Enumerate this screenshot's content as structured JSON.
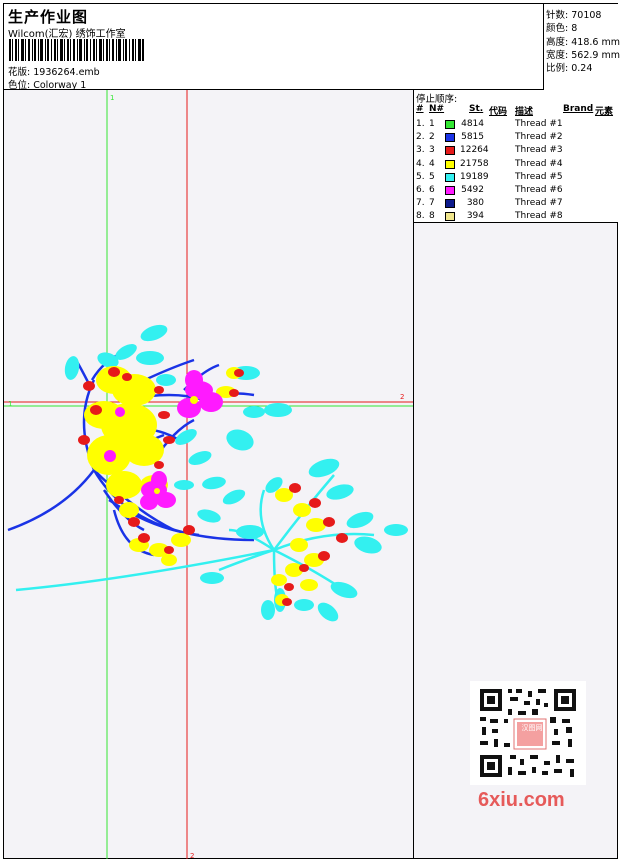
{
  "header": {
    "title": "生产作业图",
    "subtitle": "Wilcom(汇宏) 绣饰工作室",
    "design_label": "花版:",
    "design_file": "1936264.emb",
    "colorway_label": "色位:",
    "colorway": "Colorway 1"
  },
  "stats": {
    "stitches_label": "针数:",
    "stitches": "70108",
    "colors_label": "颜色:",
    "colors": "8",
    "height_label": "高度:",
    "height": "418.6 mm",
    "width_label": "宽度:",
    "width": "562.9 mm",
    "ratio_label": "比例:",
    "ratio": "0.24"
  },
  "thread_panel": {
    "title": "停止顺序:",
    "columns": {
      "index": "#",
      "needle": "N#",
      "stitches": "St.",
      "code": "代码",
      "desc": "描述",
      "brand": "Brand",
      "element": "元素"
    },
    "rows": [
      {
        "idx": "1.",
        "n": "1",
        "color": "#33e633",
        "st": "4814",
        "desc": "Thread #1"
      },
      {
        "idx": "2.",
        "n": "2",
        "color": "#1a33e6",
        "st": "5815",
        "desc": "Thread #2"
      },
      {
        "idx": "3.",
        "n": "3",
        "color": "#e61a1a",
        "st": "12264",
        "desc": "Thread #3"
      },
      {
        "idx": "4.",
        "n": "4",
        "color": "#ffff00",
        "st": "21758",
        "desc": "Thread #4"
      },
      {
        "idx": "5.",
        "n": "5",
        "color": "#33f0f0",
        "st": "19189",
        "desc": "Thread #5"
      },
      {
        "idx": "6.",
        "n": "6",
        "color": "#ff1aff",
        "st": "5492",
        "desc": "Thread #6"
      },
      {
        "idx": "7.",
        "n": "7",
        "color": "#0d1a8c",
        "st": "380",
        "desc": "Thread #7"
      },
      {
        "idx": "8.",
        "n": "8",
        "color": "#f0e68c",
        "st": "394",
        "desc": "Thread #8"
      }
    ]
  },
  "axis_labels": {
    "x_end": "2",
    "y_end": "2",
    "x_start": "1",
    "y_start": "1"
  },
  "colors": {
    "green_axis": "#33e633",
    "red_axis": "#e61a1a",
    "blue": "#1a33e6",
    "yellow": "#ffff00",
    "cyan": "#33f0f0",
    "magenta": "#ff1aff",
    "red": "#e61a1a"
  },
  "qr": {
    "stamp_text": "汉图网"
  },
  "watermark": {
    "text": "6xiu.com"
  }
}
